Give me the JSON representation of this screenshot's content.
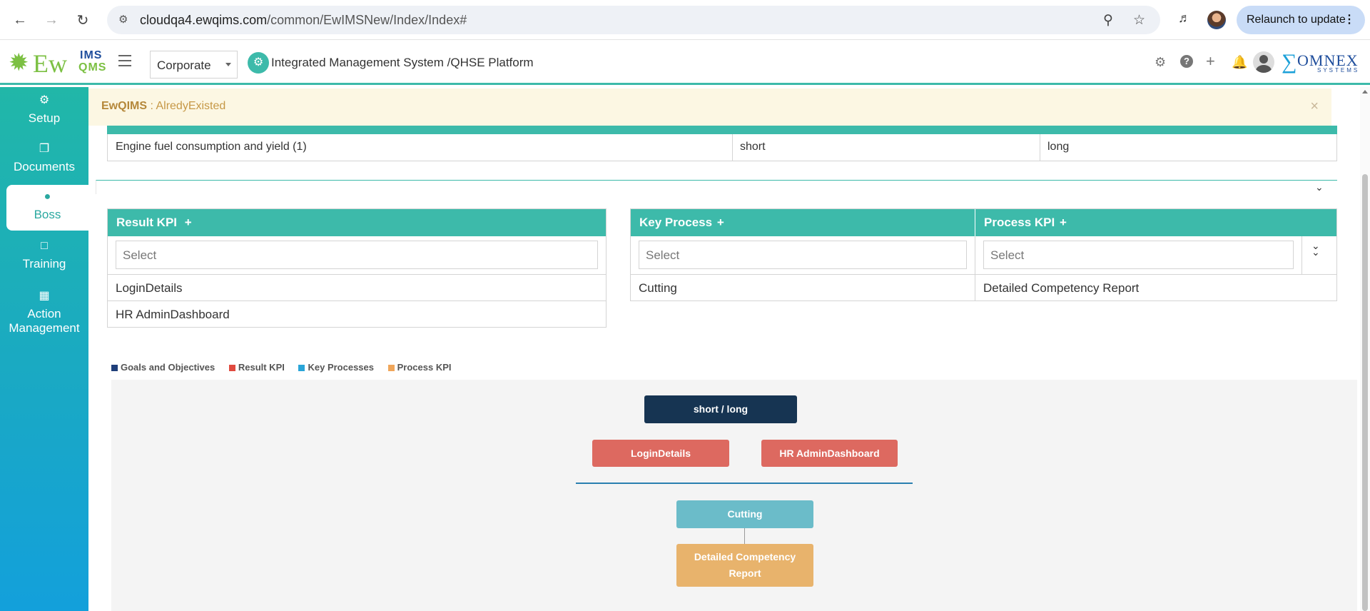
{
  "browser": {
    "url_host": "cloudqa4.ewqims.com",
    "url_path": "/common/EwIMSNew/Index/Index#",
    "relaunch_label": "Relaunch to update"
  },
  "header": {
    "logo_ew": "Ew",
    "logo_ims": "IMS",
    "logo_qms": "QMS",
    "corporate_value": "Corporate",
    "app_title": "Integrated Management System /QHSE Platform",
    "brand_name": "OMNEX",
    "brand_sub": "SYSTEMS"
  },
  "sidebar": {
    "items": [
      {
        "label": "Setup",
        "icon": "gears-icon"
      },
      {
        "label": "Documents",
        "icon": "documents-icon"
      },
      {
        "label": "Boss",
        "icon": "user-icon",
        "active": true
      },
      {
        "label": "Training",
        "icon": "training-icon"
      },
      {
        "label": "Action Management",
        "icon": "building-icon"
      }
    ]
  },
  "alert": {
    "app": "EwQIMS",
    "message": " : AlredyExisted",
    "close": "×"
  },
  "goal_row": {
    "name": "Engine fuel consumption and yield (1)",
    "short": "short",
    "long": "long"
  },
  "result_kpi": {
    "title": "Result KPI",
    "plus": "+",
    "placeholder": "Select",
    "rows": [
      "LoginDetails",
      "HR AdminDashboard"
    ]
  },
  "key_process": {
    "title": "Key Process",
    "plus": "+",
    "placeholder": "Select",
    "rows": [
      "Cutting"
    ]
  },
  "process_kpi": {
    "title": "Process KPI",
    "plus": "+",
    "placeholder": "Select",
    "rows": [
      "Detailed Competency Report"
    ]
  },
  "legend": {
    "items": [
      {
        "label": "Goals and Objectives",
        "color": "#1f3f7a"
      },
      {
        "label": "Result KPI",
        "color": "#e04a3f"
      },
      {
        "label": "Key Processes",
        "color": "#2aa5d8"
      },
      {
        "label": "Process KPI",
        "color": "#f0a65a"
      }
    ]
  },
  "diagram": {
    "goal": "short / long",
    "result_kpis": [
      "LoginDetails",
      "HR AdminDashboard"
    ],
    "key_process": "Cutting",
    "process_kpi": "Detailed Competency Report",
    "colors": {
      "goal": "#163452",
      "result": "#dd6960",
      "key": "#6bbcc9",
      "process": "#e8b36c"
    }
  }
}
